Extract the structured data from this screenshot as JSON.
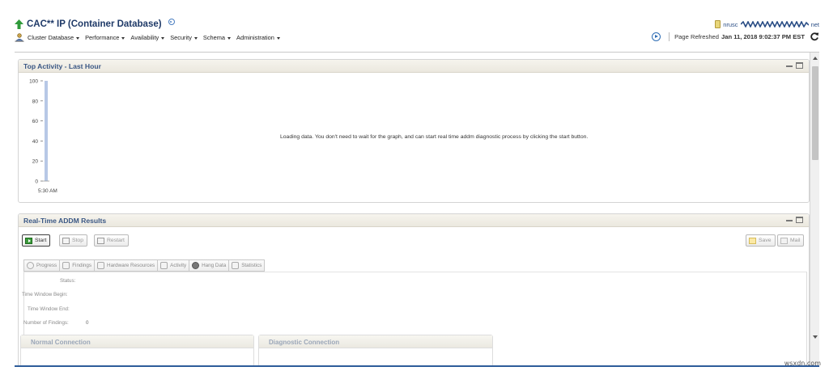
{
  "header": {
    "title": "CAC** IP (Container Database)",
    "menus": [
      "Cluster Database",
      "Performance",
      "Availability",
      "Security",
      "Schema",
      "Administration"
    ],
    "user_prefix": "nrusc",
    "user_suffix": "net",
    "page_refreshed_label": "Page Refreshed",
    "page_refreshed_value": "Jan 11, 2018 9:02:37 PM EST"
  },
  "top_activity": {
    "title": "Top Activity - Last Hour",
    "loading_message": "Loading data. You don't need to wait for the graph, and can start real time addm diagnostic process by clicking the start button."
  },
  "chart_data": {
    "type": "area",
    "title": "",
    "y_ticks": [
      "100",
      "80",
      "60",
      "40",
      "20",
      "0"
    ],
    "x_tick_labels": [
      "5:30 AM"
    ],
    "ylim": [
      0,
      100
    ],
    "grid": false
  },
  "addm": {
    "title": "Real-Time ADDM Results",
    "buttons": {
      "start": "Start",
      "stop": "Stop",
      "restart": "Restart",
      "save": "Save",
      "mail": "Mail"
    },
    "tabs": [
      "Progress",
      "Findings",
      "Hardware Resources",
      "Activity",
      "Hang Data",
      "Statistics"
    ],
    "fields": {
      "status": "Status:",
      "time_window_begin": "Time Window Begin:",
      "time_window_end": "Time Window End:",
      "number_of_findings": "Number of Findings:",
      "number_of_findings_value": "0"
    },
    "normal_connection": "Normal Connection",
    "diagnostic_connection": "Diagnostic Connection"
  },
  "watermark": "wsxdn.com",
  "colors": {
    "accent": "#3a5784",
    "title": "#1f3a68",
    "chart_bar": "#b7c8e6"
  }
}
